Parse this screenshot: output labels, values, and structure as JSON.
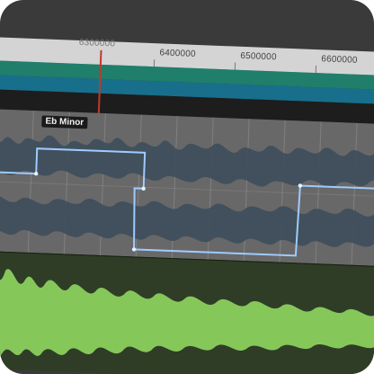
{
  "timeline": {
    "ticks": [
      "6400000",
      "6500000",
      "6600000"
    ],
    "partial_tick": "6300000"
  },
  "arranger": {
    "key_label": "Eb Minor"
  },
  "colors": {
    "ruler": "#d4d4d4",
    "green_track": "#1f7f6a",
    "blue_track": "#176f8c",
    "waveform_gray": "#3f4f5c",
    "automation_line": "#9ecbff",
    "green_wave": "#86c75a",
    "playhead": "#c0392b"
  }
}
